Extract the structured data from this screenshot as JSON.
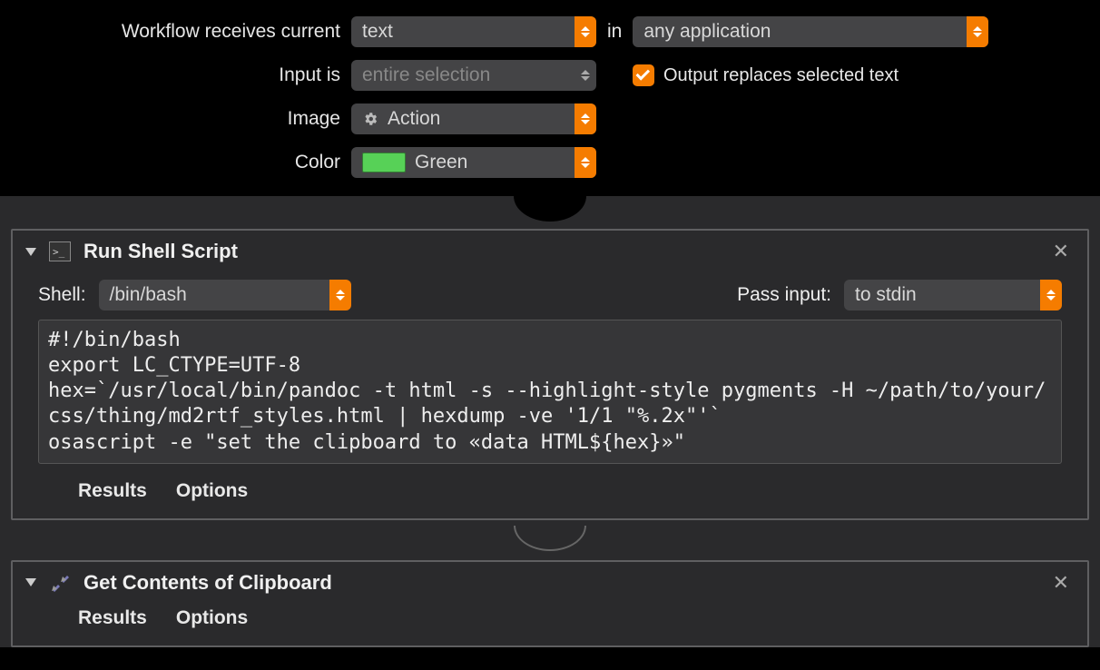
{
  "settings": {
    "workflow_label": "Workflow receives current",
    "input_type": "text",
    "in_label": "in",
    "application": "any application",
    "input_is_label": "Input is",
    "input_is_value": "entire selection",
    "output_replaces_label": "Output replaces selected text",
    "output_replaces_checked": true,
    "image_label": "Image",
    "image_value": "Action",
    "color_label": "Color",
    "color_value": "Green",
    "color_hex": "#57d157"
  },
  "action1": {
    "title": "Run Shell Script",
    "shell_label": "Shell:",
    "shell_value": "/bin/bash",
    "pass_input_label": "Pass input:",
    "pass_input_value": "to stdin",
    "script": "#!/bin/bash\nexport LC_CTYPE=UTF-8\nhex=`/usr/local/bin/pandoc -t html -s --highlight-style pygments -H ~/path/to/your/css/thing/md2rtf_styles.html | hexdump -ve '1/1 \"%.2x\"'`\nosascript -e \"set the clipboard to «data HTML${hex}»\"",
    "results_label": "Results",
    "options_label": "Options"
  },
  "action2": {
    "title": "Get Contents of Clipboard",
    "results_label": "Results",
    "options_label": "Options"
  }
}
